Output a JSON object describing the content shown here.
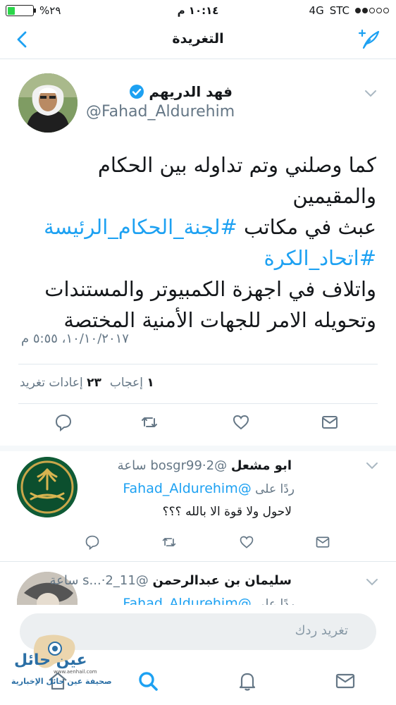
{
  "status_bar": {
    "battery": "%٢٩",
    "battery_level": 0.29,
    "time": "١٠:١٤ م",
    "network": "4G",
    "carrier": "STC"
  },
  "nav": {
    "title": "التغريدة",
    "back_icon": "chevron-left-icon",
    "compose_icon": "compose-tweet-icon"
  },
  "tweet": {
    "name": "فهد الدريهم",
    "handle": "@Fahad_Aldurehim",
    "verified": true,
    "lines": [
      {
        "parts": [
          {
            "text": "كما وصلني وتم تداوله بين الحكام والمقيمين",
            "hashtag": false
          }
        ]
      },
      {
        "parts": [
          {
            "text": "عبث في مكاتب ",
            "hashtag": false
          },
          {
            "text": "#لجنة_الحكام_الرئيسة",
            "hashtag": true
          }
        ]
      },
      {
        "parts": [
          {
            "text": "#اتحاد_الكرة",
            "hashtag": true
          }
        ]
      },
      {
        "parts": [
          {
            "text": "واتلاف في اجهزة الكمبيوتر والمستندات",
            "hashtag": false
          }
        ]
      },
      {
        "parts": [
          {
            "text": "وتحويله الامر  للجهات الأمنية المختصة",
            "hashtag": false
          }
        ]
      }
    ],
    "date": "١٠/١٠/٢٠١٧، ٥:٥٥ م",
    "likes_count": "١",
    "likes_label": "إعجاب",
    "retweets_count": "٢٣",
    "retweets_label": "إعادات تغريد",
    "actions": [
      "reply-icon",
      "retweet-icon",
      "like-icon",
      "message-icon"
    ]
  },
  "replies": [
    {
      "name": "ابو مشعل",
      "handle": "@bosgr99",
      "time": "2 ساعة",
      "replying_label": "ردًا على",
      "replying_to": "@Fahad_Aldurehim",
      "text": "لاحول ولا قوة الا بالله ؟؟؟"
    },
    {
      "name": "سليمان بن عبدالرحمن",
      "handle": "@11_s...",
      "time": "2 ساعة",
      "replying_label": "ردًا على",
      "replying_to": "@Fahad_Aldurehim"
    }
  ],
  "compose": {
    "placeholder": "تغريد ردك"
  },
  "tabbar": [
    "home-icon",
    "search-icon",
    "notifications-icon",
    "messages-icon"
  ],
  "watermark": {
    "title": "عين حائل",
    "line": "صحيفة عين حائل الإخبارية",
    "url": "www.aenhail.com"
  },
  "colors": {
    "accent": "#1da1f2",
    "text": "#14171a",
    "secondary": "#657786",
    "divider": "#e1e8ed"
  }
}
